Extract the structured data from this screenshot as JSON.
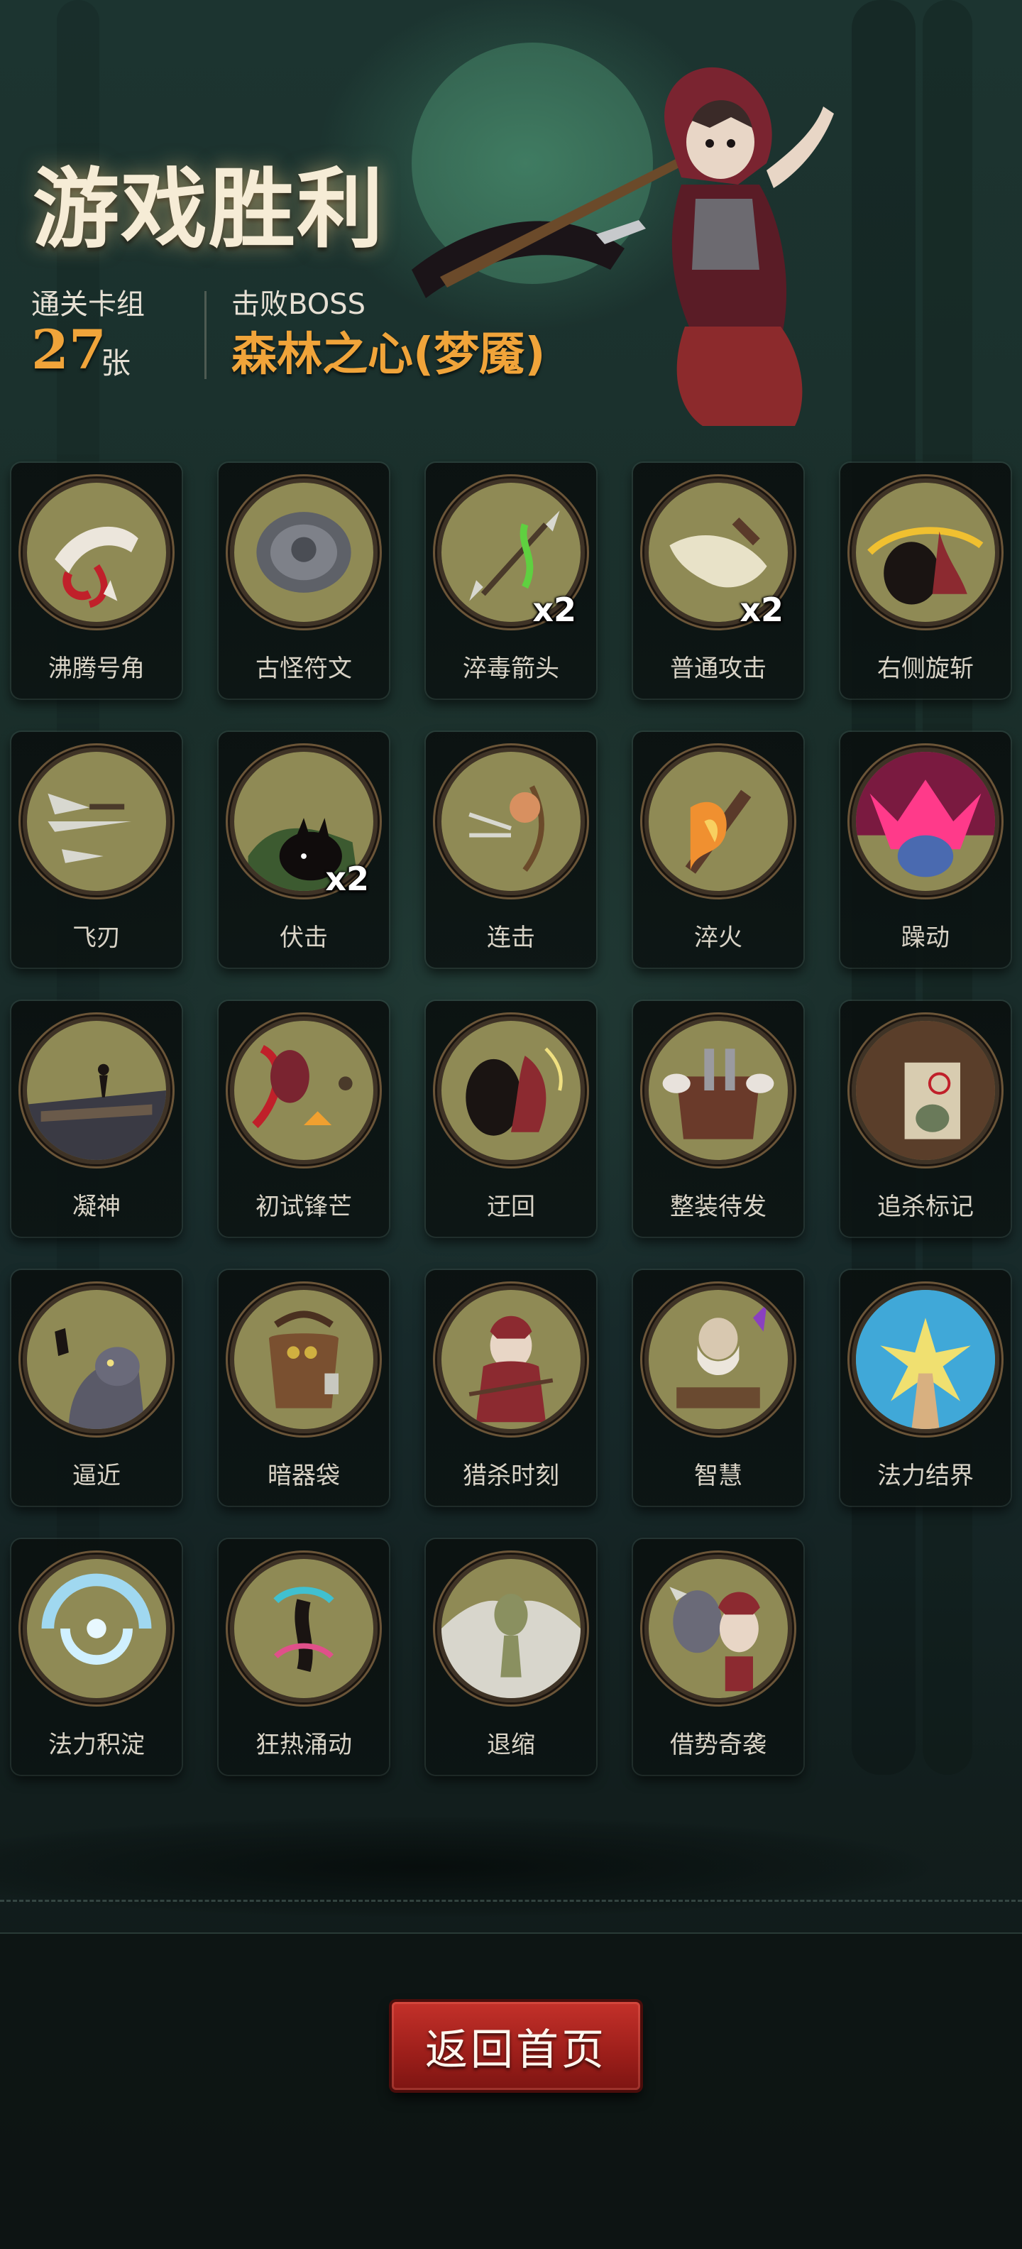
{
  "header": {
    "title": "游戏胜利",
    "deck_label": "通关卡组",
    "deck_count": "27",
    "deck_unit": "张",
    "boss_label": "击败BOSS",
    "boss_name": "森林之心(梦魇)"
  },
  "cards": [
    {
      "name": "沸腾号角",
      "qty": "",
      "art": "horn-art"
    },
    {
      "name": "古怪符文",
      "qty": "",
      "art": "rune-art"
    },
    {
      "name": "淬毒箭头",
      "qty": "x2",
      "art": "poison-arrow-art"
    },
    {
      "name": "普通攻击",
      "qty": "x2",
      "art": "basic-attack-art"
    },
    {
      "name": "右侧旋斩",
      "qty": "",
      "art": "right-spin-slash-art"
    },
    {
      "name": "飞刃",
      "qty": "",
      "art": "flying-blades-art"
    },
    {
      "name": "伏击",
      "qty": "x2",
      "art": "ambush-art"
    },
    {
      "name": "连击",
      "qty": "",
      "art": "combo-art"
    },
    {
      "name": "淬火",
      "qty": "",
      "art": "quench-art"
    },
    {
      "name": "躁动",
      "qty": "",
      "art": "restless-art"
    },
    {
      "name": "凝神",
      "qty": "",
      "art": "focus-art"
    },
    {
      "name": "初试锋芒",
      "qty": "",
      "art": "first-edge-art"
    },
    {
      "name": "迂回",
      "qty": "",
      "art": "detour-art"
    },
    {
      "name": "整装待发",
      "qty": "",
      "art": "ready-art"
    },
    {
      "name": "追杀标记",
      "qty": "",
      "art": "hunt-mark-art"
    },
    {
      "name": "逼近",
      "qty": "",
      "art": "approach-art"
    },
    {
      "name": "暗器袋",
      "qty": "",
      "art": "hidden-weapon-bag-art"
    },
    {
      "name": "猎杀时刻",
      "qty": "",
      "art": "hunting-moment-art"
    },
    {
      "name": "智慧",
      "qty": "",
      "art": "wisdom-art"
    },
    {
      "name": "法力结界",
      "qty": "",
      "art": "mana-barrier-art"
    },
    {
      "name": "法力积淀",
      "qty": "",
      "art": "mana-accumulation-art"
    },
    {
      "name": "狂热涌动",
      "qty": "",
      "art": "frenzy-surge-art"
    },
    {
      "name": "退缩",
      "qty": "",
      "art": "retreat-art"
    },
    {
      "name": "借势奇袭",
      "qty": "",
      "art": "momentum-raid-art"
    }
  ],
  "return_button": "返回首页",
  "colors": {
    "accent_orange": "#f0a43a",
    "button_red": "#b0251f",
    "card_disc": "#8f8a55",
    "card_ring": "#6b5538",
    "bg_dark": "#15221f"
  }
}
